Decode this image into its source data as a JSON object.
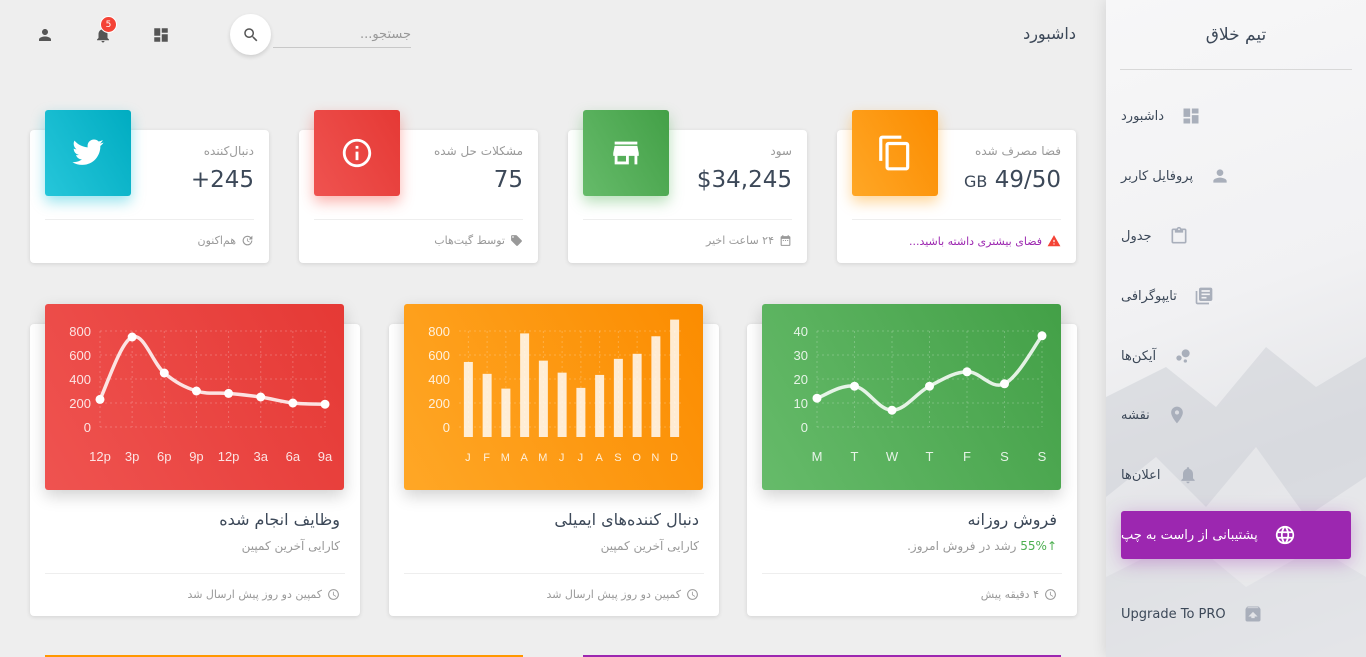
{
  "sidebar": {
    "brand": "تیم خلاق",
    "items": [
      {
        "label": "داشبورد",
        "icon": "dashboard-icon"
      },
      {
        "label": "پروفایل کاربر",
        "icon": "person-icon"
      },
      {
        "label": "جدول",
        "icon": "clipboard-icon"
      },
      {
        "label": "تایپوگرافی",
        "icon": "library-books-icon"
      },
      {
        "label": "آیکن‌ها",
        "icon": "bubble-chart-icon"
      },
      {
        "label": "نقشه",
        "icon": "location-pin-icon"
      },
      {
        "label": "اعلان‌ها",
        "icon": "bell-icon"
      },
      {
        "label": "پشتیبانی از راست به چپ",
        "icon": "globe-icon",
        "active": true
      }
    ],
    "upgrade": {
      "label": "Upgrade To PRO",
      "icon": "unarchive-icon"
    },
    "active_color": "#9c27b0"
  },
  "topbar": {
    "title": "داشبورد",
    "search_placeholder": "جستجو...",
    "notification_count": "5"
  },
  "stats": [
    {
      "category": "فضا مصرف شده",
      "value": "49/50",
      "unit": "GB",
      "footer": "فضای بیشتری داشته باشید...",
      "footer_icon": "warning-icon",
      "icon": "content-copy-icon",
      "color": "#ff9800"
    },
    {
      "category": "سود",
      "value": "$34,245",
      "footer": "۲۴ ساعت اخیر",
      "footer_icon": "calendar-icon",
      "icon": "store-icon",
      "color": "#4caf50"
    },
    {
      "category": "مشکلات حل شده",
      "value": "75",
      "footer": "توسط گیت‌هاب",
      "footer_icon": "tag-icon",
      "icon": "info-icon",
      "color": "#f44336"
    },
    {
      "category": "دنبال‌کننده",
      "value": "+245",
      "footer": "هم‌اکنون",
      "footer_icon": "update-icon",
      "icon": "twitter-icon",
      "color": "#00bcd4"
    }
  ],
  "cards": [
    {
      "title": "فروش روزانه",
      "subtitle_pct": "55%",
      "subtitle_text": "رشد در فروش امروز.",
      "footer": "۴ دقیقه پیش",
      "color": "#4caf50"
    },
    {
      "title": "دنبال کننده‌های ایمیلی",
      "subtitle_text": "کارایی آخرین کمپین",
      "footer": "کمپین دو روز پیش ارسال شد",
      "color": "#ff9800"
    },
    {
      "title": "وظایف انجام شده",
      "subtitle_text": "کارایی آخرین کمپین",
      "footer": "کمپین دو روز پیش ارسال شد",
      "color": "#f44336"
    }
  ],
  "chart_data": [
    {
      "type": "line",
      "categories": [
        "M",
        "T",
        "W",
        "T",
        "F",
        "S",
        "S"
      ],
      "values": [
        12,
        17,
        7,
        17,
        23,
        18,
        38
      ],
      "yticks": [
        0,
        10,
        20,
        30,
        40
      ],
      "ylim": [
        0,
        40
      ],
      "title": "",
      "xlabel": "",
      "ylabel": ""
    },
    {
      "type": "bar",
      "categories": [
        "J",
        "F",
        "M",
        "A",
        "M",
        "J",
        "J",
        "A",
        "S",
        "O",
        "N",
        "D"
      ],
      "values": [
        542,
        443,
        320,
        780,
        553,
        453,
        326,
        434,
        568,
        610,
        756,
        895
      ],
      "yticks": [
        0,
        200,
        400,
        600,
        800
      ],
      "ylim": [
        0,
        1000
      ],
      "title": "",
      "xlabel": "",
      "ylabel": ""
    },
    {
      "type": "line",
      "categories": [
        "12p",
        "3p",
        "6p",
        "9p",
        "12p",
        "3a",
        "6a",
        "9a"
      ],
      "values": [
        230,
        750,
        450,
        300,
        280,
        250,
        200,
        190
      ],
      "yticks": [
        0,
        200,
        400,
        600,
        800
      ],
      "ylim": [
        0,
        1000
      ],
      "title": "",
      "xlabel": "",
      "ylabel": ""
    }
  ]
}
